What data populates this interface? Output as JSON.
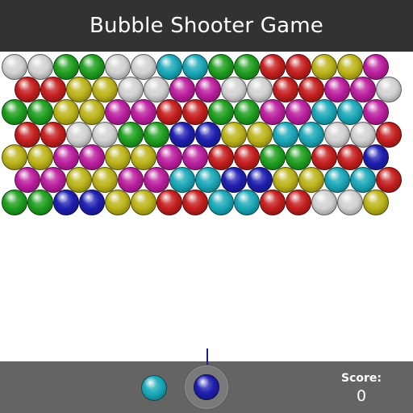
{
  "header": {
    "title": "Bubble Shooter Game"
  },
  "colors": {
    "W": "#d2d2d2",
    "R": "#c41e1e",
    "G": "#1e9e1e",
    "Y": "#bcb41a",
    "C": "#1aa8b8",
    "M": "#bc1e9e",
    "B": "#1e1eb0"
  },
  "grid": [
    "WWGGWWCCGGRRYYM",
    "RRYYWWMMWWRRMMW",
    "GGYYMMRRGGMMCCM",
    "RRWWGGBBYYCCWWR",
    "YYMMYYMMRRGGRRB",
    "MMYYMMCCBBYYCCR",
    "GGBBYYRRCCRRWWY"
  ],
  "shooter": {
    "next_color": "C",
    "current_color": "B"
  },
  "score": {
    "label": "Score:",
    "value": "0"
  }
}
